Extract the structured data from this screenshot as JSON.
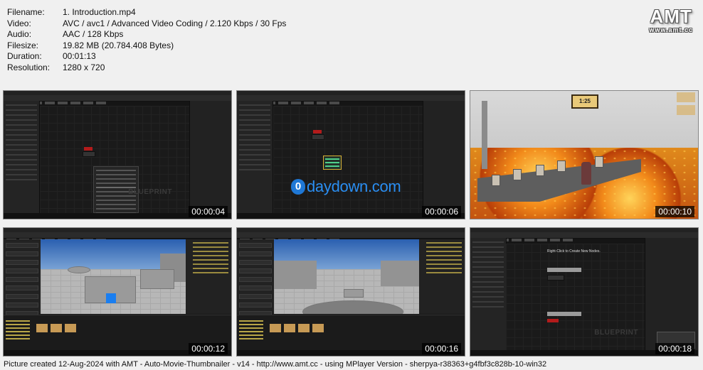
{
  "meta": {
    "rows": [
      {
        "key": "Filename:",
        "value": "1. Introduction.mp4"
      },
      {
        "key": "Video:",
        "value": "AVC / avc1 / Advanced Video Coding / 2.120 Kbps / 30 Fps"
      },
      {
        "key": "Audio:",
        "value": "AAC / 128 Kbps"
      },
      {
        "key": "Filesize:",
        "value": "19.82 MB (20.784.408 Bytes)"
      },
      {
        "key": "Duration:",
        "value": "00:01:13"
      },
      {
        "key": "Resolution:",
        "value": "1280 x 720"
      }
    ]
  },
  "logo": {
    "mark": "AMT",
    "url": "www.amt.cc"
  },
  "thumbnails": [
    {
      "timestamp": "00:00:04",
      "watermark": "BLUEPRINT"
    },
    {
      "timestamp": "00:00:06",
      "overlay": "daydown.com",
      "overlay_icon": "0"
    },
    {
      "timestamp": "00:00:10",
      "sign": "1:25"
    },
    {
      "timestamp": "00:00:12"
    },
    {
      "timestamp": "00:00:16"
    },
    {
      "timestamp": "00:00:18",
      "hint": "Right-Click to Create New Nodes.",
      "watermark": "BLUEPRINT"
    }
  ],
  "footer": "Picture created 12-Aug-2024 with AMT - Auto-Movie-Thumbnailer - v14 - http://www.amt.cc - using MPlayer Version - sherpya-r38363+g4fbf3c828b-10-win32"
}
